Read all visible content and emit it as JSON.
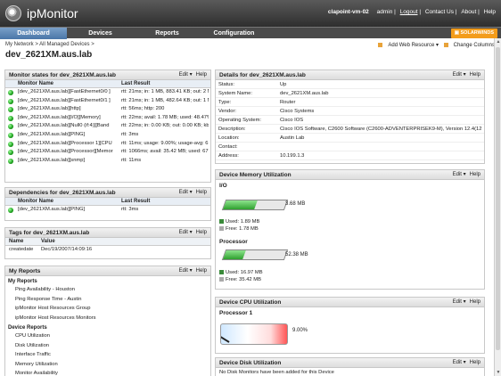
{
  "app": {
    "logo": "ipMonitor",
    "host": "clapoint-vm-02",
    "links": [
      "admin",
      "Logout",
      "Contact Us",
      "About",
      "Help"
    ]
  },
  "nav": {
    "tabs": [
      "Dashboard",
      "Devices",
      "Reports",
      "Configuration"
    ],
    "solarwinds": "SOLARWINDS"
  },
  "breadcrumb": "My Network > All Managed Devices >",
  "page_title": "dev_2621XM.aus.lab",
  "actions": {
    "add": "Add Web Resource",
    "change": "Change Columns"
  },
  "monitor": {
    "title": "Monitor states for dev_2621XM.aus.lab",
    "edit": "Edit",
    "help": "Help",
    "col1": "Monitor Name",
    "col2": "Last Result",
    "rows": [
      [
        "[dev_2621XM.aus.lab][FastEthernet0/0 ]",
        "rtt: 21ms; in: 1 MB, 883.41 KB; out: 2 MB"
      ],
      [
        "[dev_2621XM.aus.lab][FastEthernet0/1 ]",
        "rtt: 21ms; in: 1 MB, 482.64 KB; out: 1 MB"
      ],
      [
        "[dev_2621XM.aus.lab][http]",
        "rtt: 56ms; http: 200"
      ],
      [
        "[dev_2621XM.aus.lab][I/O][Memory]",
        "rtt: 22ms; avail: 1.78 MB; used: 48.47%;"
      ],
      [
        "[dev_2621XM.aus.lab][Null0 (if:4)][Band",
        "rtt: 22ms; in: 0.00 KB; out: 0.00 KB; kb/s"
      ],
      [
        "[dev_2621XM.aus.lab][PING]",
        "rtt: 3ms"
      ],
      [
        "[dev_2621XM.aus.lab][Processor 1][CPU",
        "rtt: 11ms; usage: 9.00%; usage-avg: 6.2"
      ],
      [
        "[dev_2621XM.aus.lab][Processor][Memor",
        "rtt: 1066ms; avail: 35.42 MB; used: 67.6"
      ],
      [
        "[dev_2621XM.aus.lab][snmp]",
        "rtt: 11ms"
      ]
    ]
  },
  "deps": {
    "title": "Dependencies for dev_2621XM.aus.lab",
    "edit": "Edit",
    "help": "Help",
    "col1": "Monitor Name",
    "col2": "Last Result",
    "rows": [
      [
        "[dev_2621XM.aus.lab][PING]",
        "rtt: 3ms"
      ]
    ]
  },
  "tags": {
    "title": "Tags for dev_2621XM.aus.lab",
    "edit": "Edit",
    "help": "Help",
    "col1": "Name",
    "col2": "Value",
    "rows": [
      [
        "createdate",
        "Dec/19/2007/14:09:16"
      ]
    ]
  },
  "reports": {
    "title": "My Reports",
    "edit": "Edit",
    "help": "Help",
    "groups": [
      {
        "name": "My Reports",
        "items": [
          "Ping Availability - Houston",
          "Ping Response Time - Austin",
          "ipMonitor Host Resources Group",
          "ipMonitor Host Resources Monitors"
        ]
      },
      {
        "name": "Device Reports",
        "items": [
          "CPU Utilization",
          "Disk Utilization",
          "Interface Traffic",
          "Memory Utilization",
          "Monitor Availability"
        ]
      }
    ]
  },
  "details": {
    "title": "Details for dev_2621XM.aus.lab",
    "edit": "Edit",
    "help": "Help",
    "rows": [
      [
        "Status:",
        "Up"
      ],
      [
        "System Name:",
        "dev_2621XM.aus.lab"
      ],
      [
        "Type:",
        "Router"
      ],
      [
        "Vendor:",
        "Cisco Systems"
      ],
      [
        "Operating System:",
        "Cisco IOS"
      ],
      [
        "Description:",
        "Cisco IOS Software, C2600 Software (C2600-ADVENTERPRISEK9-M), Version 12.4(12"
      ],
      [
        "Location:",
        "Austin Lab"
      ],
      [
        "Contact:",
        ""
      ],
      [
        "Address:",
        "10.199.1.3"
      ]
    ]
  },
  "memory": {
    "title": "Device Memory Utilization",
    "edit": "Edit",
    "help": "Help",
    "items": [
      {
        "name": "I/O",
        "total": "3.68 MB",
        "used": "Used: 1.89 MB",
        "free": "Free: 1.78 MB",
        "used_fraction": 0.51
      },
      {
        "name": "Processor",
        "total": "52.38 MB",
        "used": "Used: 16.97 MB",
        "free": "Free: 35.42 MB",
        "used_fraction": 0.32
      }
    ]
  },
  "cpu": {
    "title": "Device CPU Utilization",
    "edit": "Edit",
    "help": "Help",
    "name": "Processor 1",
    "value": "9.00%"
  },
  "disk": {
    "title": "Device Disk Utilization",
    "edit": "Edit",
    "help": "Help",
    "msg": "No Disk Monitors have been added for this Device"
  }
}
